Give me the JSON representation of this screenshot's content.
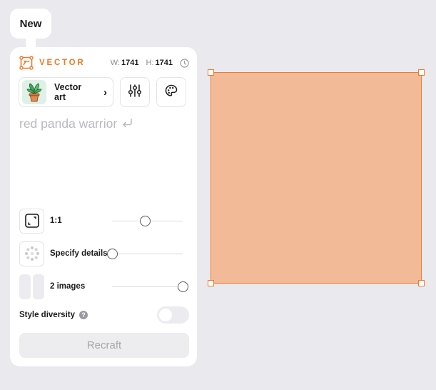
{
  "tab": {
    "label": "New"
  },
  "header": {
    "brand": "VECTOR",
    "width_label": "W:",
    "width_value": "1741",
    "height_label": "H:",
    "height_value": "1741",
    "brand_color": "#ef7a2a"
  },
  "style_picker": {
    "name": "Vector art",
    "thumbnail_icon": "potted-plant-icon",
    "chevron_icon": "chevron-right-icon"
  },
  "toolbar": {
    "settings_icon": "sliders-icon",
    "palette_icon": "palette-icon"
  },
  "prompt": {
    "text": "red panda warrior",
    "submit_icon": "return-arrow-icon"
  },
  "options": {
    "aspect_ratio": {
      "label": "1:1",
      "icon": "aspect-ratio-icon",
      "level": 0.47
    },
    "details": {
      "label": "Specify details",
      "icon": "dotted-circle-icon",
      "level": 0.0
    },
    "images": {
      "label": "2 images",
      "icon": "two-panels-icon",
      "level": 1.0
    }
  },
  "style_diversity": {
    "label": "Style diversity",
    "help_icon": "help-question-icon",
    "enabled": false
  },
  "generate_button": {
    "label": "Recraft"
  },
  "canvas": {
    "fill_color": "#f3ba98",
    "border_color": "#ef7a2a"
  }
}
